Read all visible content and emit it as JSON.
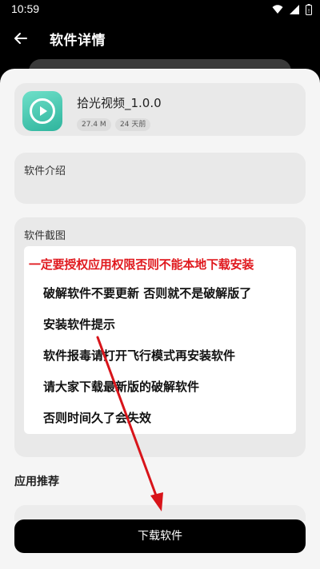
{
  "status_bar": {
    "time": "10:59"
  },
  "app_bar": {
    "title": "软件详情"
  },
  "app": {
    "name": "拾光视频_1.0.0",
    "size": "27.4 M",
    "updated": "24 天前"
  },
  "intro": {
    "label": "软件介绍"
  },
  "screenshots": {
    "label": "软件截图",
    "notice_title": "一定要授权应用权限否则不能本地下载安装",
    "notice_lines": [
      "破解软件不要更新 否则就不是破解版了",
      "安装软件提示",
      "软件报毒请打开飞行模式再安装软件",
      "请大家下载最新版的破解软件",
      "否则时间久了会失效"
    ]
  },
  "recommend": {
    "label": "应用推荐"
  },
  "download": {
    "label": "下载软件"
  },
  "colors": {
    "accent_red": "#e0191e",
    "icon_teal": "#2eb49d",
    "button": "#000000"
  }
}
